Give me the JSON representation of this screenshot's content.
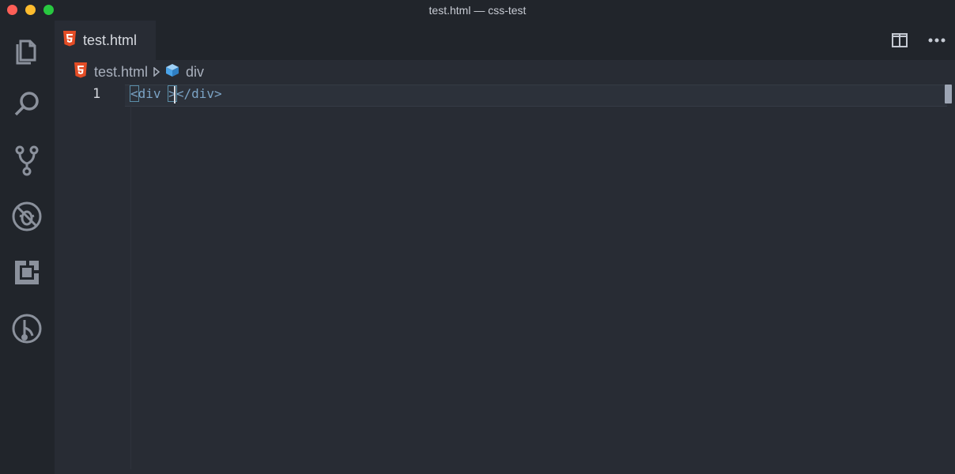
{
  "window": {
    "title": "test.html — css-test"
  },
  "activity_bar": {
    "items": [
      {
        "name": "explorer-icon"
      },
      {
        "name": "search-icon"
      },
      {
        "name": "source-control-icon"
      },
      {
        "name": "debug-icon"
      },
      {
        "name": "extensions-icon"
      },
      {
        "name": "git-graph-icon"
      }
    ]
  },
  "tabs": [
    {
      "label": "test.html",
      "icon": "html5-icon",
      "active": true
    }
  ],
  "toolbar": {
    "split_editor": "split-editor-icon",
    "more_actions": "ellipsis-icon"
  },
  "breadcrumb": {
    "file": "test.html",
    "element": "div"
  },
  "editor": {
    "lines": [
      {
        "number": "1",
        "parts": [
          "<",
          "div ",
          ">",
          "</div>"
        ]
      }
    ]
  },
  "colors": {
    "background": "#282c34",
    "sidebar": "#21252b",
    "html_icon": "#e44d26",
    "code": "#7ba3c5"
  }
}
